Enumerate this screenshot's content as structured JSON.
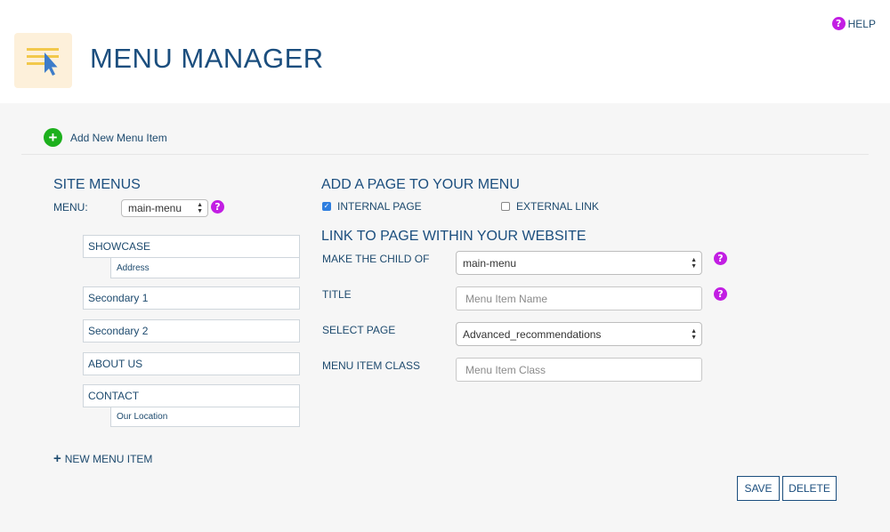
{
  "header": {
    "title": "MENU MANAGER",
    "help_label": "HELP",
    "help_icon": "?"
  },
  "toolbar": {
    "add_new_label": "Add New Menu Item",
    "add_icon": "+"
  },
  "site_menus": {
    "heading": "SITE MENUS",
    "menu_label": "MENU:",
    "menu_selected": "main-menu",
    "items": [
      {
        "label": "SHOWCASE",
        "children": [
          "Address"
        ]
      },
      {
        "label": "Secondary 1",
        "children": []
      },
      {
        "label": "Secondary 2",
        "children": []
      },
      {
        "label": "ABOUT US",
        "children": []
      },
      {
        "label": "CONTACT",
        "children": [
          "Our Location"
        ]
      }
    ],
    "new_item_label": "NEW MENU ITEM"
  },
  "add_page": {
    "heading": "ADD A PAGE TO YOUR MENU",
    "internal_label": "INTERNAL PAGE",
    "internal_checked": true,
    "external_label": "EXTERNAL LINK",
    "external_checked": false
  },
  "link_form": {
    "heading": "LINK TO PAGE WITHIN YOUR WEBSITE",
    "child_of_label": "MAKE THE CHILD OF",
    "child_of_value": "main-menu",
    "title_label": "TITLE",
    "title_placeholder": "Menu Item Name",
    "select_page_label": "SELECT PAGE",
    "select_page_value": "Advanced_recommendations",
    "class_label": "MENU ITEM CLASS",
    "class_placeholder": "Menu Item Class"
  },
  "actions": {
    "save_label": "SAVE",
    "delete_label": "DELETE"
  },
  "colors": {
    "primary": "#1b4e7e",
    "help_purple": "#c21ee3",
    "add_green": "#1db01d",
    "content_bg": "#f6f6f6"
  }
}
